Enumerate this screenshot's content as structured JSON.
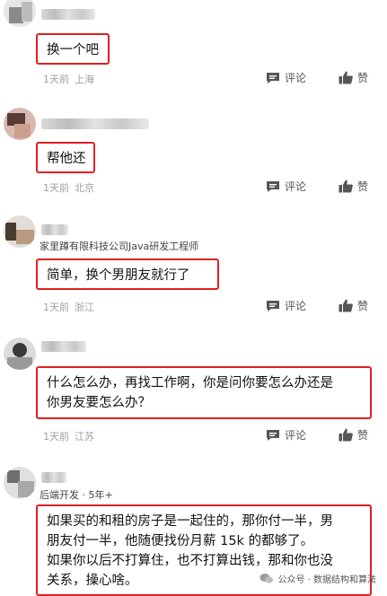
{
  "comments": [
    {
      "subtitle": "",
      "lines": [
        "换一个吧"
      ],
      "time": "1天前",
      "location": "上海",
      "reply_label": "评论",
      "like_label": "赞"
    },
    {
      "subtitle": "",
      "lines": [
        "帮他还"
      ],
      "time": "1天前",
      "location": "北京",
      "reply_label": "评论",
      "like_label": "赞"
    },
    {
      "subtitle": "家里蹲有限科技公司Java研发工程师",
      "lines": [
        "简单，换个男朋友就行了"
      ],
      "time": "1天前",
      "location": "浙江",
      "reply_label": "评论",
      "like_label": "赞"
    },
    {
      "subtitle": "",
      "lines": [
        "什么怎么办，再找工作啊，你是问你要怎么办还是",
        "你男友要怎么办？"
      ],
      "time": "1天前",
      "location": "江苏",
      "reply_label": "评论",
      "like_label": "赞"
    },
    {
      "subtitle": "后端开发 · 5年+",
      "lines": [
        "如果买的和租的房子是一起住的，那你付一半，男",
        "朋友付一半，他随便找份月薪 15k 的都够了。",
        "如果你以后不打算住，也不打算出钱，那和你也没",
        "关系，操心啥。"
      ]
    }
  ],
  "watermark": "公众号 · 数据结构和算法",
  "colors": {
    "highlight_border": "#e02020",
    "meta_text": "#9aa0a6"
  },
  "icons": {
    "reply": "comment-bubble-icon",
    "like": "thumbs-up-icon",
    "watermark": "wechat-icon"
  }
}
